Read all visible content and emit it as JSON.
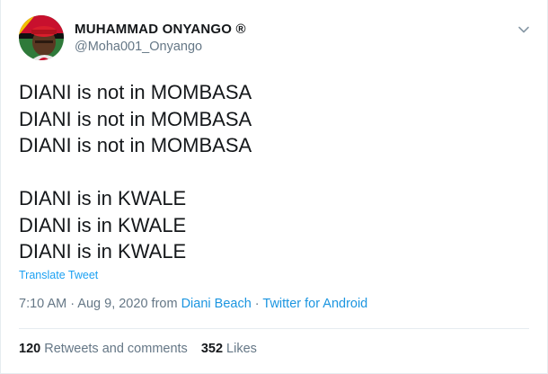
{
  "author": {
    "display_name": "MUHAMMAD ONYANGO ®",
    "handle": "@Moha001_Onyango",
    "avatar_icon": "profile-avatar"
  },
  "menu": {
    "icon": "chevron-down-icon"
  },
  "tweet": {
    "lines": [
      "DIANI is not in MOMBASA",
      "DIANI is not in MOMBASA",
      "DIANI is not in MOMBASA",
      "",
      "DIANI is in KWALE",
      "DIANI is in KWALE",
      "DIANI is in KWALE"
    ],
    "translate_label": "Translate Tweet"
  },
  "meta": {
    "time": "7:10 AM",
    "separator": " · ",
    "date": "Aug 9, 2020",
    "from_prefix": " from ",
    "location": "Diani Beach",
    "source": "Twitter for Android"
  },
  "stats": {
    "retweets_count": "120",
    "retweets_label": " Retweets and comments",
    "likes_count": "352",
    "likes_label": " Likes"
  },
  "colors": {
    "link": "#1b95e0",
    "accent": "#1da1f2",
    "secondary_text": "#657786",
    "primary_text": "#14171a",
    "border": "#e6ecf0"
  }
}
